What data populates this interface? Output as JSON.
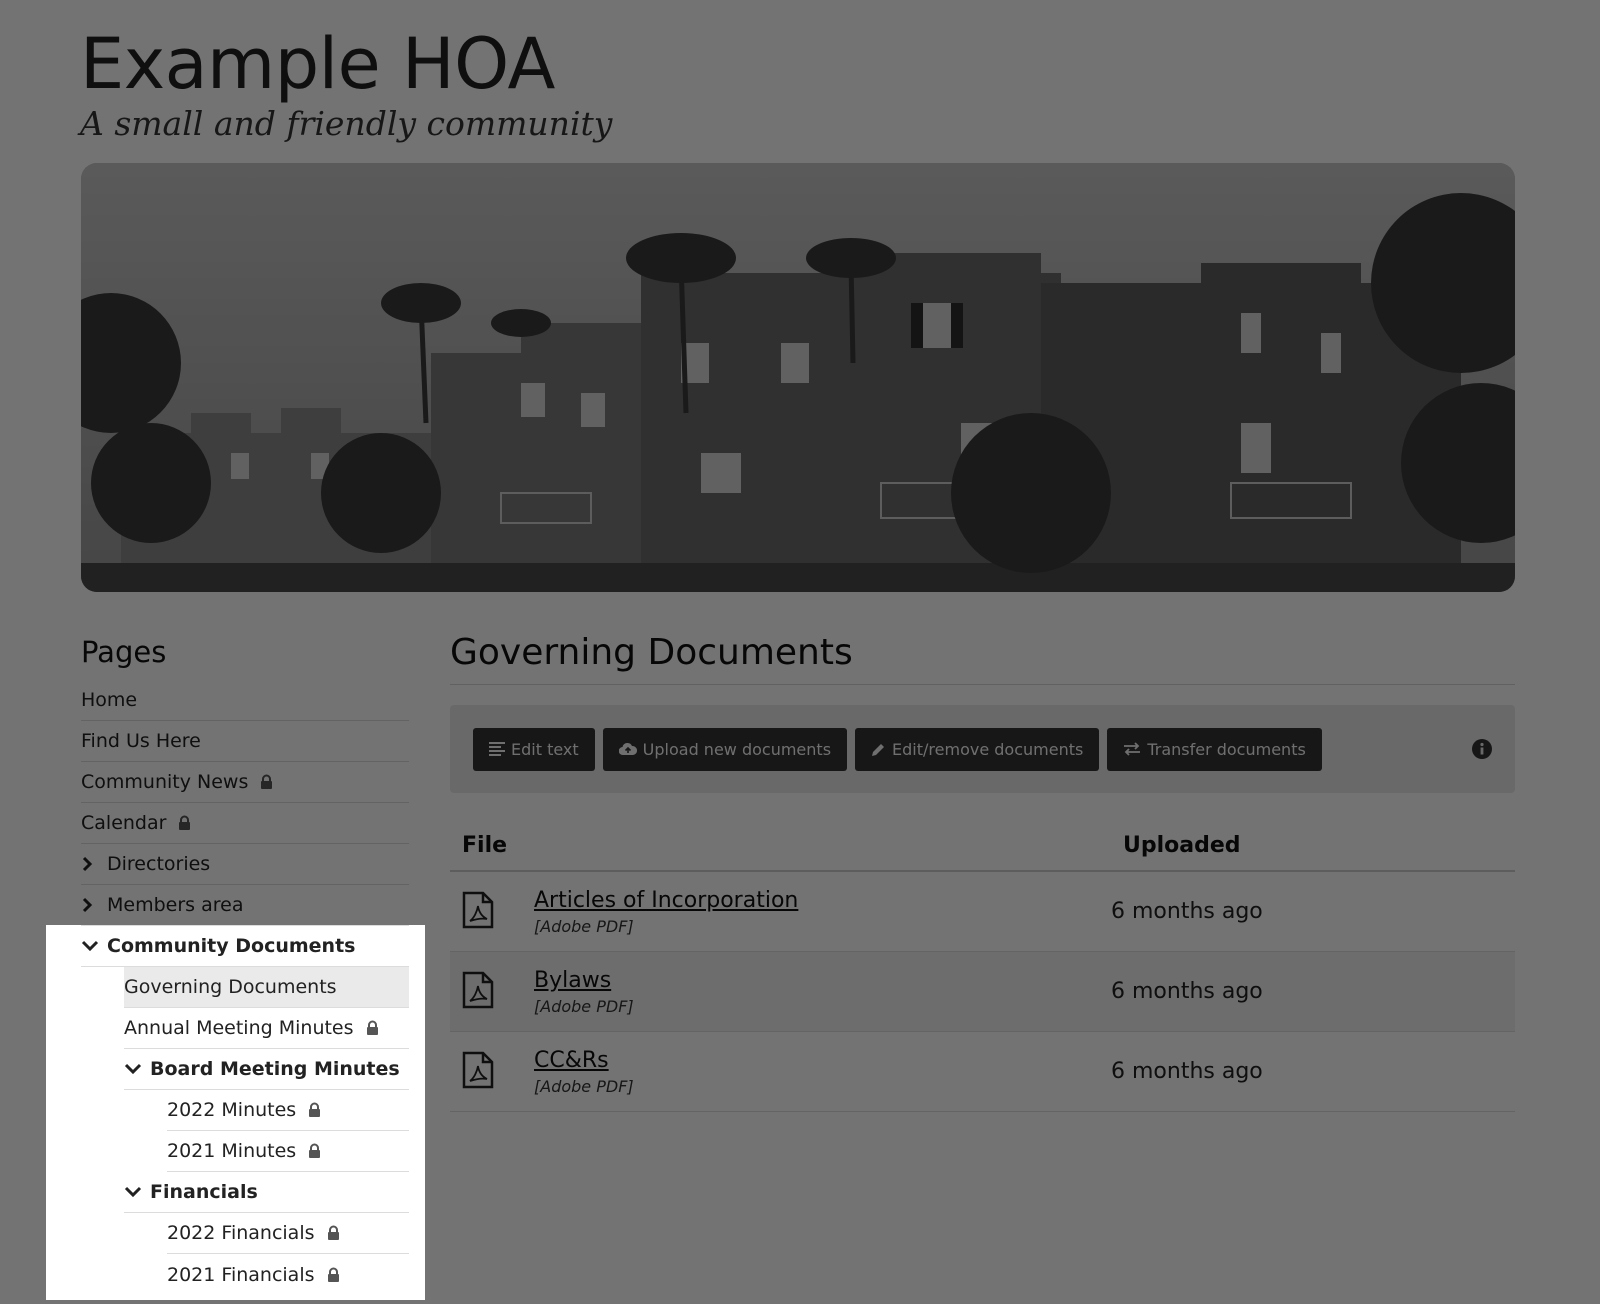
{
  "site": {
    "title": "Example HOA",
    "tagline": "A small and friendly community"
  },
  "sidebar": {
    "heading": "Pages",
    "items": [
      {
        "label": "Home"
      },
      {
        "label": "Find Us Here"
      },
      {
        "label": "Community News",
        "locked": true
      },
      {
        "label": "Calendar",
        "locked": true
      },
      {
        "label": "Directories",
        "collapsed": true
      },
      {
        "label": "Members area",
        "collapsed": true
      },
      {
        "label": "Community Documents",
        "expanded": true
      },
      {
        "label": "Governing Documents",
        "active": true
      },
      {
        "label": "Annual Meeting Minutes",
        "locked": true
      },
      {
        "label": "Board Meeting Minutes",
        "expanded": true
      },
      {
        "label": "2022 Minutes",
        "locked": true
      },
      {
        "label": "2021 Minutes",
        "locked": true
      },
      {
        "label": "Financials",
        "expanded": true
      },
      {
        "label": "2022 Financials",
        "locked": true
      },
      {
        "label": "2021 Financials",
        "locked": true
      }
    ]
  },
  "main": {
    "title": "Governing Documents",
    "toolbar": {
      "edit_text": "Edit text",
      "upload": "Upload new documents",
      "edit_remove": "Edit/remove documents",
      "transfer": "Transfer documents"
    },
    "table": {
      "headers": [
        "File",
        "Uploaded"
      ],
      "rows": [
        {
          "name": "Articles of Incorporation",
          "type": "[Adobe PDF]",
          "uploaded": "6 months ago"
        },
        {
          "name": "Bylaws",
          "type": "[Adobe PDF]",
          "uploaded": "6 months ago"
        },
        {
          "name": "CC&Rs",
          "type": "[Adobe PDF]",
          "uploaded": "6 months ago"
        }
      ]
    }
  },
  "icons": {
    "lock": "lock-icon",
    "chevron_right": "chevron-right-icon",
    "chevron_down": "chevron-down-icon",
    "pdf": "pdf-file-icon",
    "info": "info-icon"
  },
  "colors": {
    "button_bg": "#333333",
    "overlay": "rgba(0,0,0,0.55)"
  }
}
